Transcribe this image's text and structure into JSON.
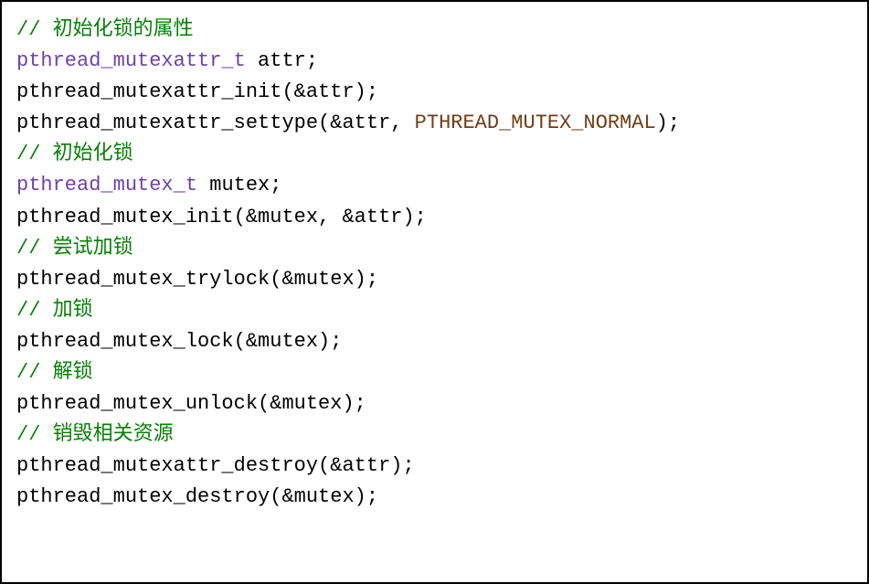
{
  "code": {
    "line1_comment": "// 初始化锁的属性",
    "line2_type": "pthread_mutexattr_t",
    "line2_rest": " attr;",
    "line3": "pthread_mutexattr_init(&attr);",
    "line4_pre": "pthread_mutexattr_settype(&attr, ",
    "line4_const": "PTHREAD_MUTEX_NORMAL",
    "line4_post": ");",
    "line5_comment": "// 初始化锁",
    "line6_type": "pthread_mutex_t",
    "line6_rest": " mutex;",
    "line7": "pthread_mutex_init(&mutex, &attr);",
    "line8_comment": "// 尝试加锁",
    "line9": "pthread_mutex_trylock(&mutex);",
    "line10_comment": "// 加锁",
    "line11": "pthread_mutex_lock(&mutex);",
    "line12_comment": "// 解锁",
    "line13": "pthread_mutex_unlock(&mutex);",
    "line14_comment": "// 销毁相关资源",
    "line15": "pthread_mutexattr_destroy(&attr);",
    "line16": "pthread_mutex_destroy(&mutex);"
  }
}
